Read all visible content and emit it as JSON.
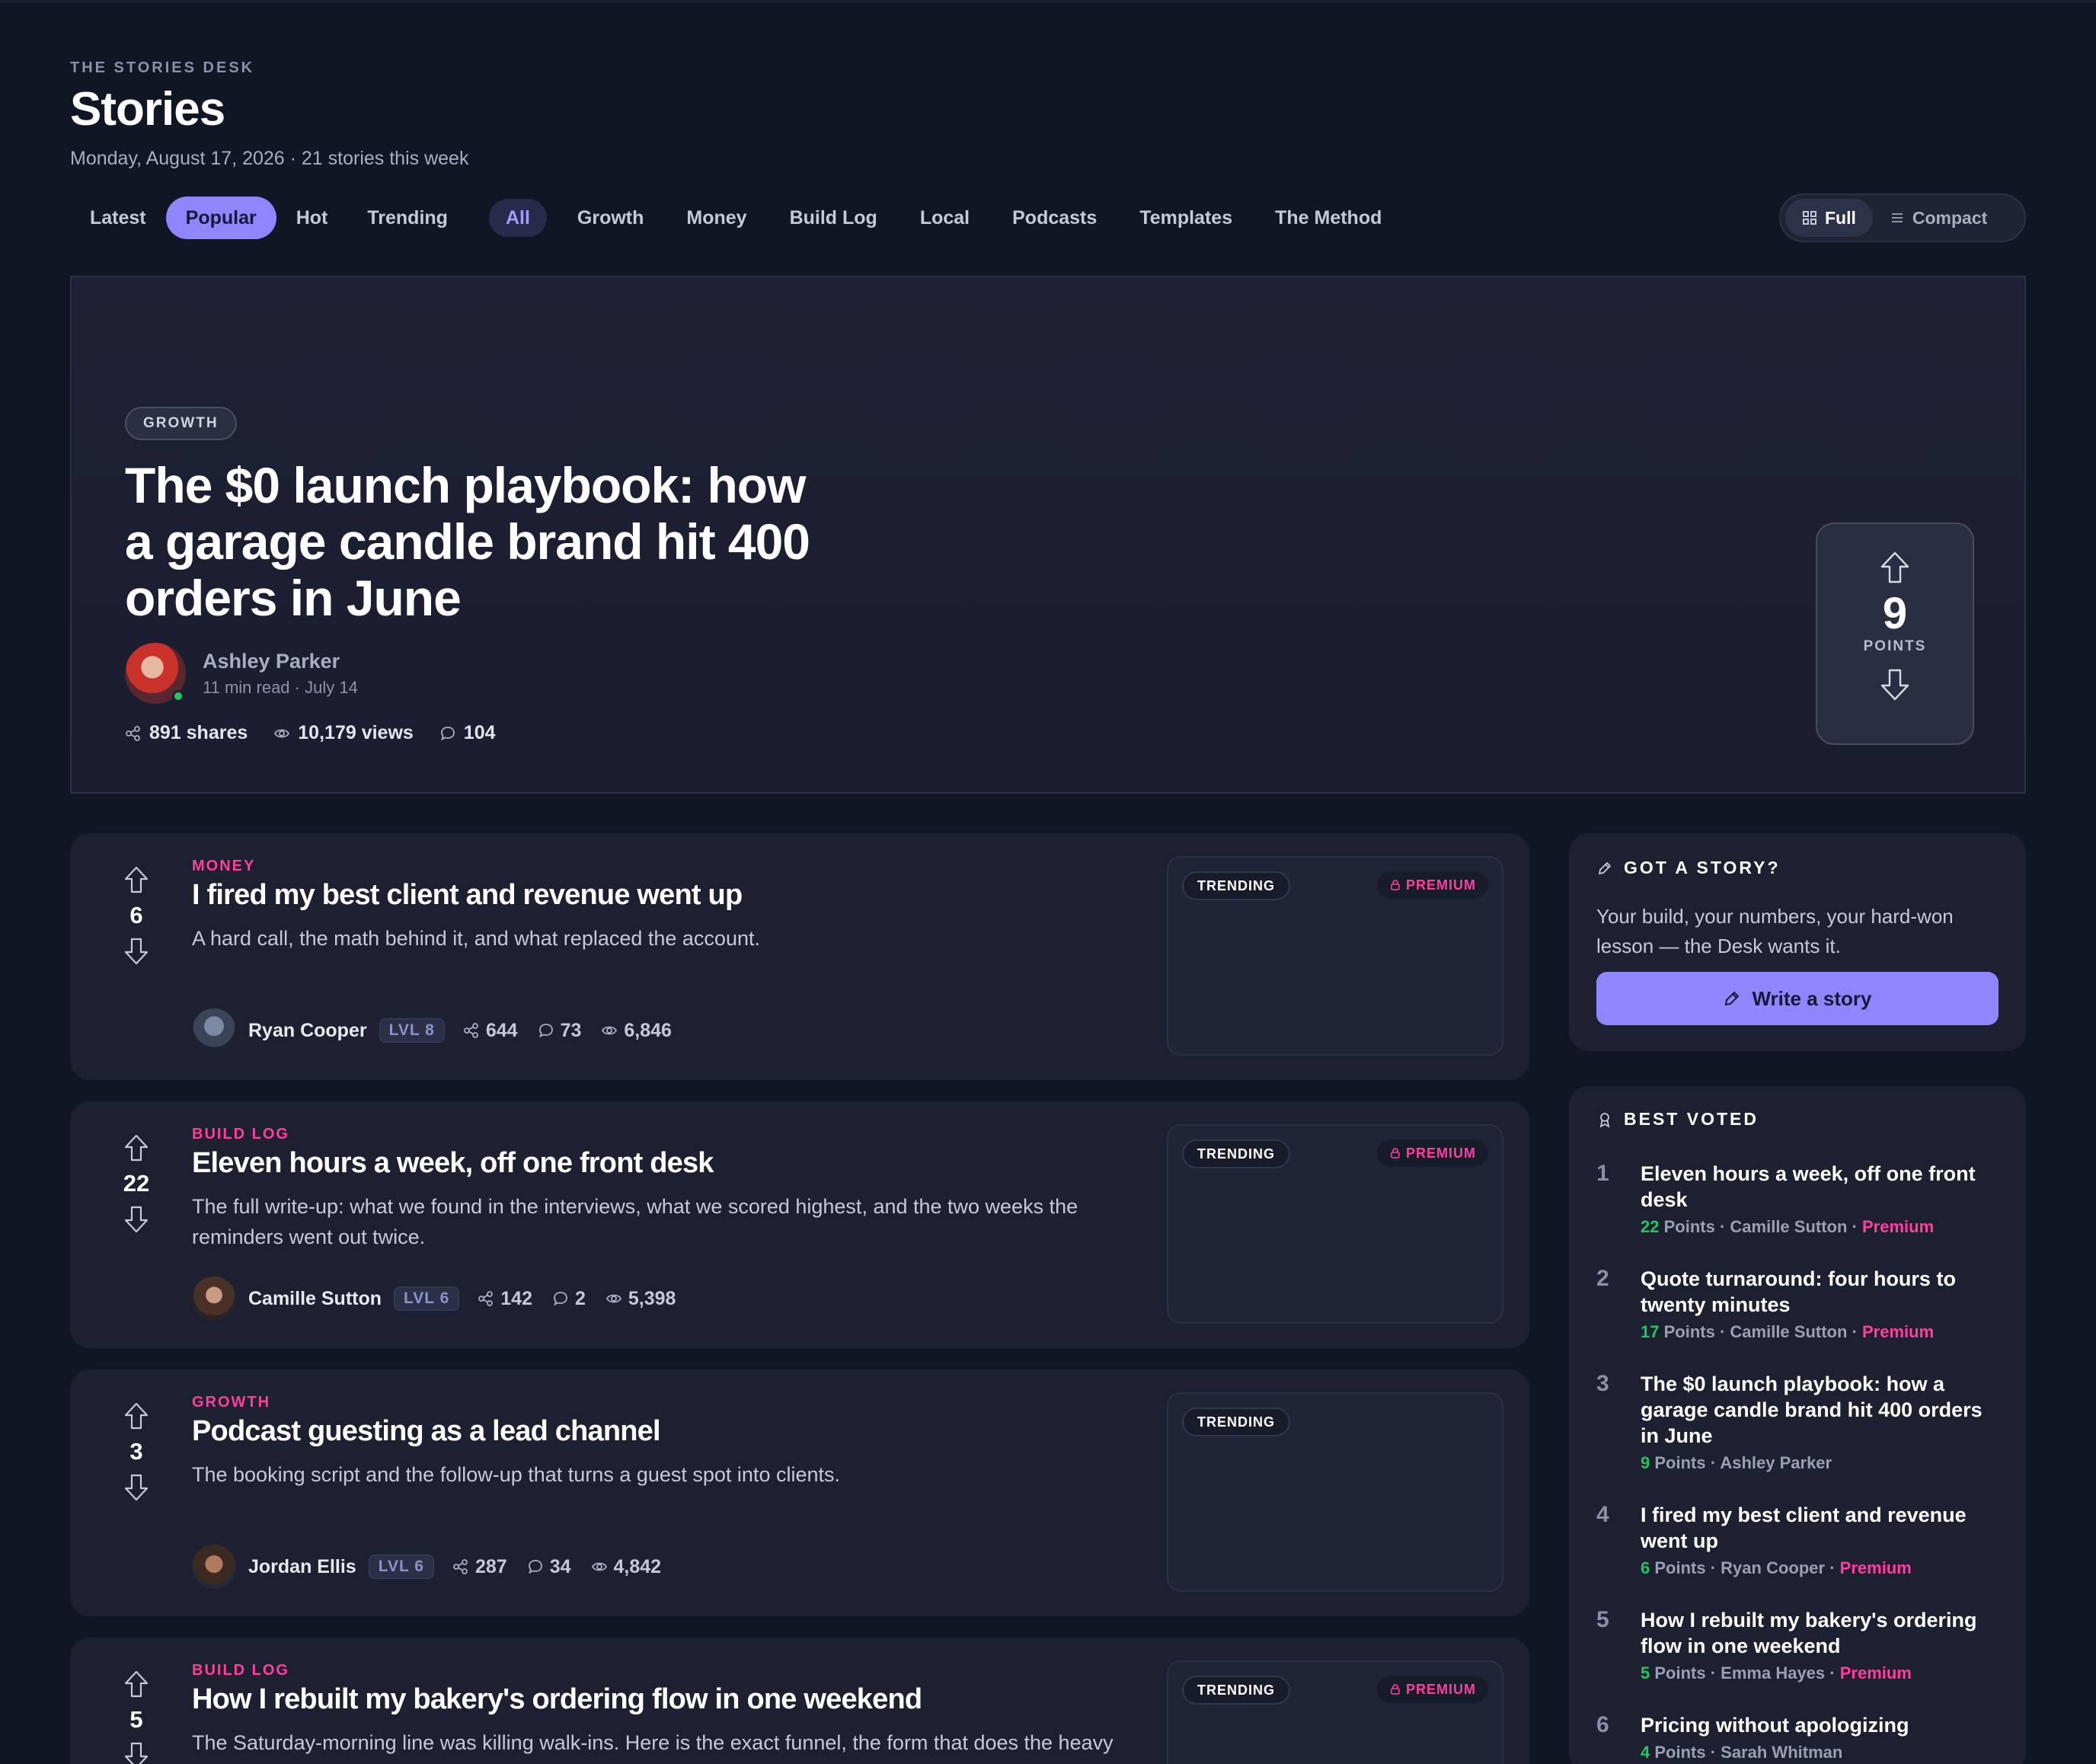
{
  "header": {
    "kicker": "THE STORIES DESK",
    "title": "Stories",
    "subline": "Monday, August 17, 2026 · 21 stories this week"
  },
  "sort_tabs": [
    {
      "label": "Latest",
      "active": false
    },
    {
      "label": "Popular",
      "active": true
    },
    {
      "label": "Hot",
      "active": false
    },
    {
      "label": "Trending",
      "active": false
    }
  ],
  "category_tabs": [
    {
      "label": "All",
      "active": true
    },
    {
      "label": "Growth",
      "active": false
    },
    {
      "label": "Money",
      "active": false
    },
    {
      "label": "Build Log",
      "active": false
    },
    {
      "label": "Local",
      "active": false
    },
    {
      "label": "Podcasts",
      "active": false
    },
    {
      "label": "Templates",
      "active": false
    },
    {
      "label": "The Method",
      "active": false
    }
  ],
  "view_toggle": {
    "full": "Full",
    "compact": "Compact",
    "selected": "Full"
  },
  "hero": {
    "category": "GROWTH",
    "title": "The $0 launch playbook: how a garage candle brand hit 400 orders in June",
    "author": "Ashley Parker",
    "meta": "11 min read · July 14",
    "shares": "891 shares",
    "views": "10,179 views",
    "comments": "104",
    "points": "9",
    "points_label": "POINTS"
  },
  "stories": [
    {
      "category": "MONEY",
      "title": "I fired my best client and revenue went up",
      "description": "A hard call, the math behind it, and what replaced the account.",
      "points": "6",
      "author": "Ryan Cooper",
      "level": "LVL 8",
      "shares": "644",
      "comments": "73",
      "views": "6,846",
      "trending": "TRENDING",
      "premium": "PREMIUM"
    },
    {
      "category": "BUILD LOG",
      "title": "Eleven hours a week, off one front desk",
      "description": "The full write-up: what we found in the interviews, what we scored highest, and the two weeks the reminders went out twice.",
      "points": "22",
      "author": "Camille Sutton",
      "level": "LVL 6",
      "shares": "142",
      "comments": "2",
      "views": "5,398",
      "trending": "TRENDING",
      "premium": "PREMIUM"
    },
    {
      "category": "GROWTH",
      "title": "Podcast guesting as a lead channel",
      "description": "The booking script and the follow-up that turns a guest spot into clients.",
      "points": "3",
      "author": "Jordan Ellis",
      "level": "LVL 6",
      "shares": "287",
      "comments": "34",
      "views": "4,842",
      "trending": "TRENDING",
      "premium": ""
    },
    {
      "category": "BUILD LOG",
      "title": "How I rebuilt my bakery's ordering flow in one weekend",
      "description": "The Saturday-morning line was killing walk-ins. Here is the exact funnel, the form that does the heavy",
      "points": "5",
      "trending": "TRENDING",
      "premium": "PREMIUM"
    }
  ],
  "got_a_story": {
    "heading": "GOT A STORY?",
    "text": "Your build, your numbers, your hard-won lesson — the Desk wants it.",
    "button": "Write a story"
  },
  "best_voted": {
    "heading": "BEST VOTED",
    "items": [
      {
        "rank": "1",
        "title": "Eleven hours a week, off one front desk",
        "points": "22",
        "points_label": "Points",
        "author": "Camille Sutton",
        "premium": "Premium"
      },
      {
        "rank": "2",
        "title": "Quote turnaround: four hours to twenty minutes",
        "points": "17",
        "points_label": "Points",
        "author": "Camille Sutton",
        "premium": "Premium"
      },
      {
        "rank": "3",
        "title": "The $0 launch playbook: how a garage candle brand hit 400 orders in June",
        "points": "9",
        "points_label": "Points",
        "author": "Ashley Parker",
        "premium": ""
      },
      {
        "rank": "4",
        "title": "I fired my best client and revenue went up",
        "points": "6",
        "points_label": "Points",
        "author": "Ryan Cooper",
        "premium": "Premium"
      },
      {
        "rank": "5",
        "title": "How I rebuilt my bakery's ordering flow in one weekend",
        "points": "5",
        "points_label": "Points",
        "author": "Emma Hayes",
        "premium": "Premium"
      },
      {
        "rank": "6",
        "title": "Pricing without apologizing",
        "points": "4",
        "points_label": "Points",
        "author": "Sarah Whitman",
        "premium": ""
      }
    ]
  },
  "colors": {
    "background": "#111624",
    "card": "#1d2030",
    "accent": "#8f86ff",
    "category": "#ff3f9f",
    "points_green": "#22c55e"
  }
}
